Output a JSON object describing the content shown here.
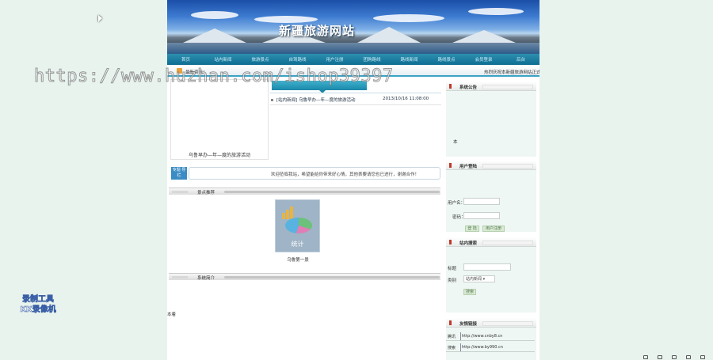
{
  "site": {
    "title": "新疆旅游网站"
  },
  "nav": [
    "首页",
    "站内新闻",
    "旅游景点",
    "自驾路线",
    "用户注册",
    "团购路线",
    "路线新闻",
    "路线景点",
    "会员登录",
    "后台"
  ],
  "ticker": {
    "label": "最新资讯：",
    "scroll_text": "热烈庆祝本新疆旅游网站正式"
  },
  "featured": {
    "caption": "乌鲁早办—年—度的旅游活动"
  },
  "news": {
    "items": [
      {
        "text": "[站内新闻] 乌鲁早办—年—度的旅游活动",
        "date": "2013/10/16 11:08:00"
      }
    ]
  },
  "message": {
    "icon_text": "专题\n导栏",
    "text": "欢迎莅临我站，希望能给你带来好心情，其他表要请您也已进行，谢谢合作！"
  },
  "sections": {
    "recommend": "景点推荐",
    "intro": "系统简介"
  },
  "recommend": {
    "image_word": "统计",
    "caption": "乌鲁第一景"
  },
  "footer": {
    "text": "本着"
  },
  "right": {
    "notice": {
      "title": "系统公告",
      "content": "本"
    },
    "login": {
      "title": "用户登陆",
      "username_label": "用户名：",
      "password_label": "密码：",
      "login_button": "登 陆",
      "register_button": "用户注册"
    },
    "search": {
      "title": "站内搜索",
      "title_label": "标题",
      "type_label": "类别",
      "type_value": "站内新闻",
      "search_button": "搜索"
    },
    "links": {
      "title": "友情链接",
      "items": [
        {
          "name": "腾讯",
          "url": "http://www.cnby8.cn"
        },
        {
          "name": "搜索",
          "url": "http://www.by990.cn"
        }
      ]
    }
  },
  "overlay": {
    "watermark": "https://www.huzhan.com/ishop39397",
    "recorder_line1": "录制工具",
    "recorder_line2": "KK录像机"
  }
}
